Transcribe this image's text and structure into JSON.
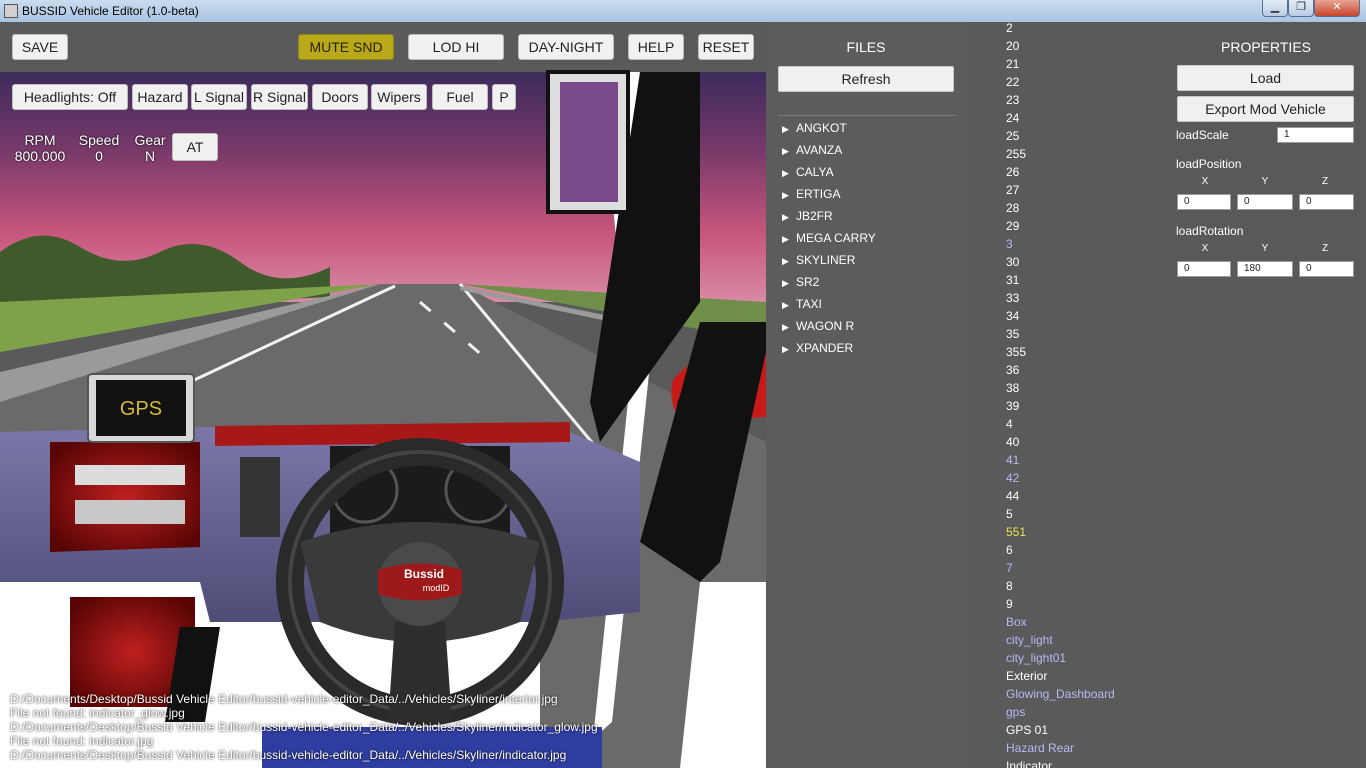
{
  "window": {
    "title": "BUSSID Vehicle Editor (1.0-beta)",
    "minimize": "▁",
    "maximize": "❐",
    "close": "✕"
  },
  "toolbar": {
    "save": "SAVE",
    "mute_snd": "MUTE SND",
    "lod_hi": "LOD HI",
    "day_night": "DAY-NIGHT",
    "help": "HELP",
    "reset": "RESET"
  },
  "controls": {
    "headlights": "Headlights: Off",
    "hazard": "Hazard",
    "l_signal": "L Signal",
    "r_signal": "R Signal",
    "doors": "Doors",
    "wipers": "Wipers",
    "fuel": "Fuel",
    "p": "P"
  },
  "gauges": {
    "rpm_label": "RPM",
    "rpm_value": "800.000",
    "speed_label": "Speed",
    "speed_value": "0",
    "gear_label": "Gear",
    "gear_value": "N",
    "transmission": "AT"
  },
  "scene": {
    "gps_label": "GPS",
    "wheel_logo_top": "Bussid",
    "wheel_logo_bottom": "modID"
  },
  "log": [
    "D:/Documents/Desktop/Bussid Vehicle Editor/bussid-vehicle-editor_Data/../Vehicles/Skyliner/interior.jpg",
    "File not found: indicator_glow.jpg",
    "D:/Documents/Desktop/Bussid Vehicle Editor/bussid-vehicle-editor_Data/../Vehicles/Skyliner/indicator_glow.jpg",
    "File not found: indicator.jpg",
    "D:/Documents/Desktop/Bussid Vehicle Editor/bussid-vehicle-editor_Data/../Vehicles/Skyliner/indicator.jpg"
  ],
  "files": {
    "title": "FILES",
    "refresh": "Refresh",
    "items": [
      "ANGKOT",
      "AVANZA",
      "CALYA",
      "ERTIGA",
      "JB2FR",
      "MEGA CARRY",
      "SKYLINER",
      "SR2",
      "TAXI",
      "WAGON R",
      "XPANDER"
    ]
  },
  "parts": [
    {
      "label": "2",
      "style": "normal"
    },
    {
      "label": "20",
      "style": "normal"
    },
    {
      "label": "21",
      "style": "normal"
    },
    {
      "label": "22",
      "style": "normal"
    },
    {
      "label": "23",
      "style": "normal"
    },
    {
      "label": "24",
      "style": "normal"
    },
    {
      "label": "25",
      "style": "normal"
    },
    {
      "label": "255",
      "style": "normal"
    },
    {
      "label": "26",
      "style": "normal"
    },
    {
      "label": "27",
      "style": "normal"
    },
    {
      "label": "28",
      "style": "normal"
    },
    {
      "label": "29",
      "style": "normal"
    },
    {
      "label": "3",
      "style": "dim"
    },
    {
      "label": "30",
      "style": "normal"
    },
    {
      "label": "31",
      "style": "normal"
    },
    {
      "label": "33",
      "style": "normal"
    },
    {
      "label": "34",
      "style": "normal"
    },
    {
      "label": "35",
      "style": "normal"
    },
    {
      "label": "355",
      "style": "normal"
    },
    {
      "label": "36",
      "style": "normal"
    },
    {
      "label": "38",
      "style": "normal"
    },
    {
      "label": "39",
      "style": "normal"
    },
    {
      "label": "4",
      "style": "normal"
    },
    {
      "label": "40",
      "style": "normal"
    },
    {
      "label": "41",
      "style": "dim"
    },
    {
      "label": "42",
      "style": "dim"
    },
    {
      "label": "44",
      "style": "normal"
    },
    {
      "label": "5",
      "style": "normal"
    },
    {
      "label": "551",
      "style": "sel"
    },
    {
      "label": "6",
      "style": "normal"
    },
    {
      "label": "7",
      "style": "dim"
    },
    {
      "label": "8",
      "style": "normal"
    },
    {
      "label": "9",
      "style": "normal"
    },
    {
      "label": "Box",
      "style": "dim"
    },
    {
      "label": "city_light",
      "style": "dim"
    },
    {
      "label": "city_light01",
      "style": "dim"
    },
    {
      "label": "Exterior",
      "style": "normal"
    },
    {
      "label": "Glowing_Dashboard",
      "style": "dim"
    },
    {
      "label": "gps",
      "style": "dim"
    },
    {
      "label": "GPS 01",
      "style": "normal"
    },
    {
      "label": "Hazard Rear",
      "style": "dim"
    },
    {
      "label": "Indicator",
      "style": "normal"
    }
  ],
  "properties": {
    "title": "PROPERTIES",
    "load": "Load",
    "export": "Export Mod Vehicle",
    "load_scale_label": "loadScale",
    "load_scale": "1",
    "load_position_label": "loadPosition",
    "load_rotation_label": "loadRotation",
    "axis_x": "X",
    "axis_y": "Y",
    "axis_z": "Z",
    "pos_x": "0",
    "pos_y": "0",
    "pos_z": "0",
    "rot_x": "0",
    "rot_y": "180",
    "rot_z": "0"
  },
  "colors": {
    "accent_yellow": "#b8a81a",
    "selected_part": "#e9e54f",
    "inactive_part": "#b4bbf0"
  }
}
